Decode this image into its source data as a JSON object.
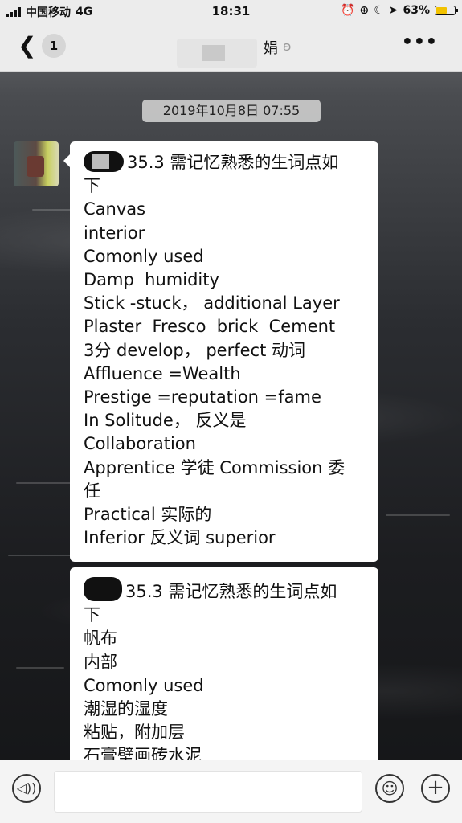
{
  "status_bar": {
    "carrier": "中国移动",
    "network": "4G",
    "time": "18:31",
    "battery_percent": "63%",
    "battery_level": 0.63,
    "icons": [
      "signal-icon",
      "alarm-icon",
      "lock-rotation-icon",
      "moon-icon",
      "location-icon",
      "battery-icon"
    ]
  },
  "nav": {
    "unread_count": "1",
    "title": "娟",
    "icons": [
      "back-icon",
      "ear-icon",
      "more-icon"
    ]
  },
  "chat": {
    "timestamp": "2019年10月8日 07:55",
    "message1": {
      "lines": [
        "35.3 需记忆熟悉的生词点如",
        "下",
        "Canvas",
        "interior",
        "Comonly used",
        "Damp  humidity",
        "Stick -stuck， additional Layer",
        "Plaster  Fresco  brick  Cement",
        "3分 develop， perfect 动词",
        "Affluence =Wealth",
        "Prestige =reputation =fame",
        "In Solitude， 反义是",
        "Collaboration",
        "Apprentice 学徒 Commission 委",
        "任",
        "Practical 实际的",
        "Inferior 反义词 superior"
      ]
    },
    "message2": {
      "lines": [
        "35.3 需记忆熟悉的生词点如",
        "下",
        "帆布",
        "内部",
        "Comonly used",
        "潮湿的湿度",
        "粘贴，附加层",
        "石膏壁画砖水泥"
      ]
    }
  },
  "input_bar": {
    "placeholder": "",
    "icons": [
      "voice-icon",
      "emoji-icon",
      "plus-icon"
    ]
  },
  "colors": {
    "bar_background": "#ececec",
    "bubble": "#ffffff",
    "battery": "#f2c200"
  }
}
